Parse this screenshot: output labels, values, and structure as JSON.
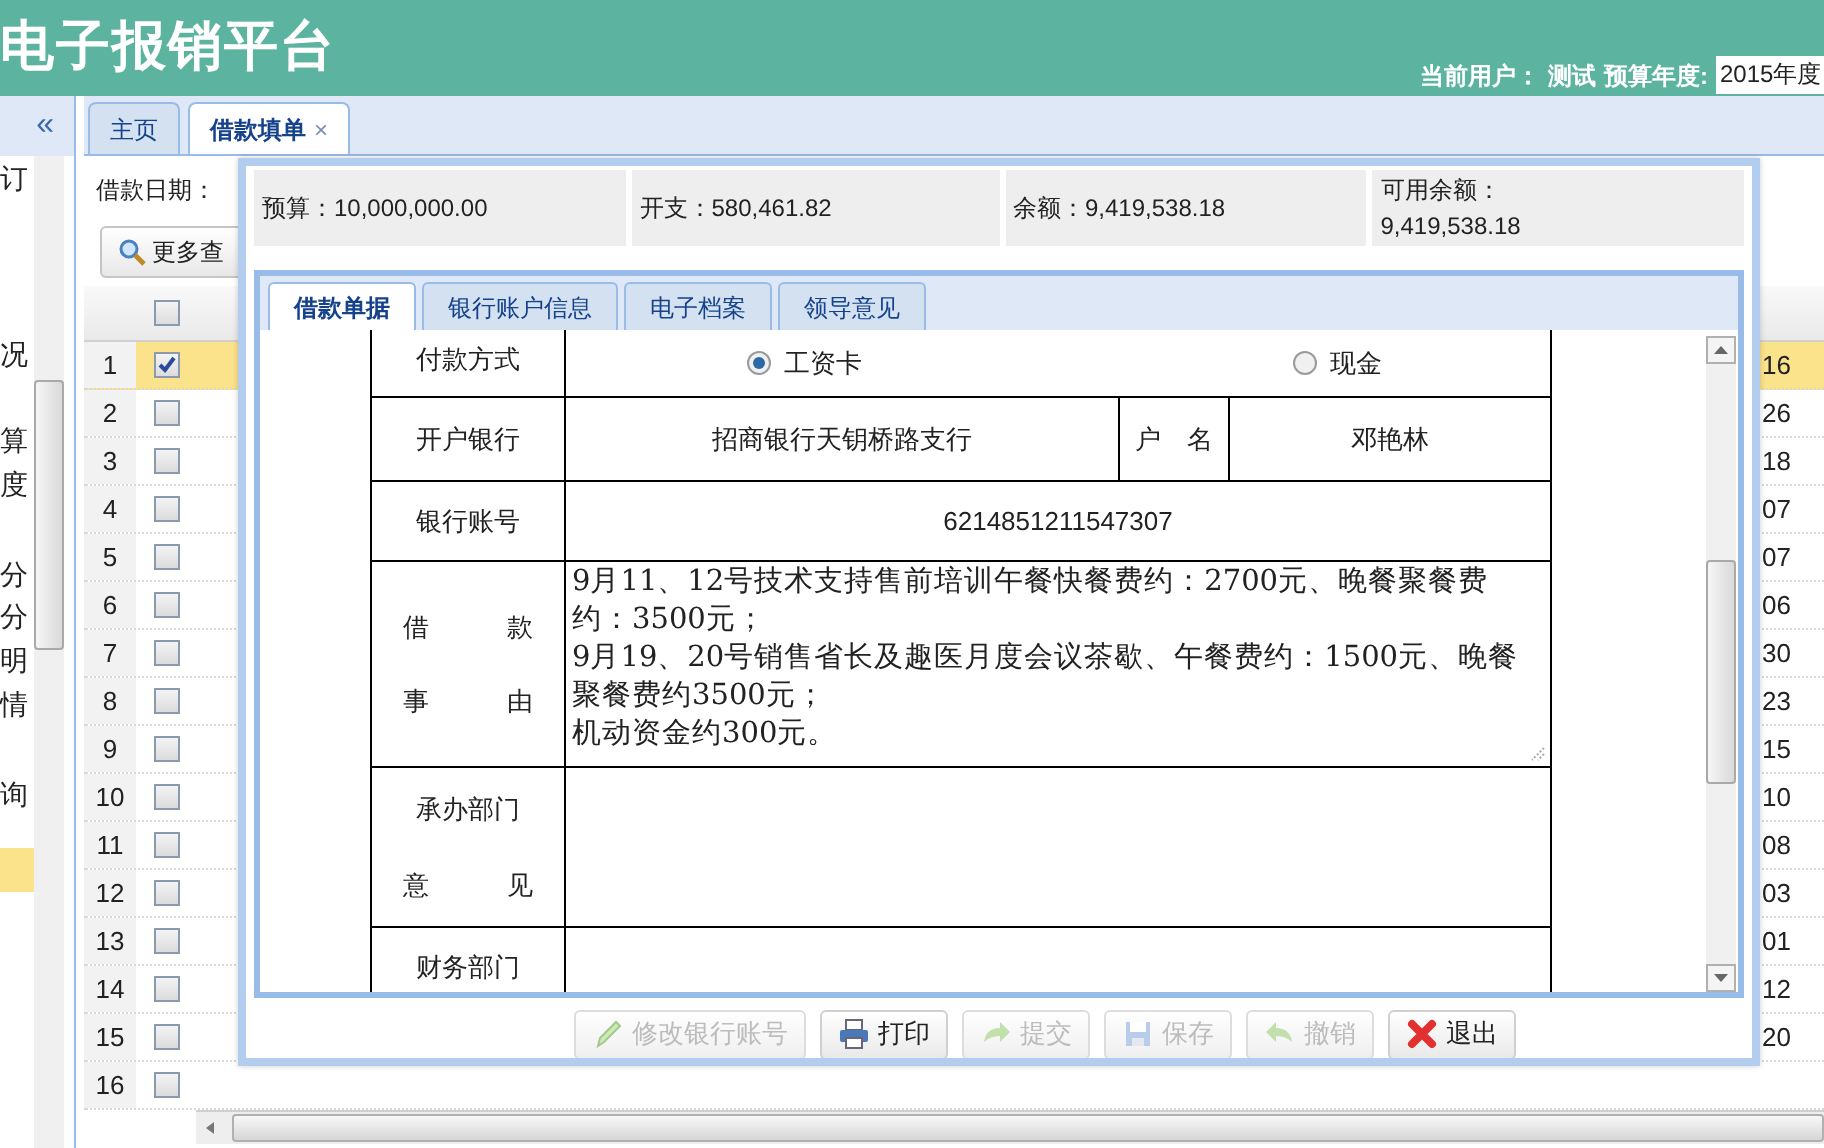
{
  "header": {
    "title": "电子报销平台",
    "user_label": "当前用户：",
    "user_name": "测试",
    "year_label": "预算年度:",
    "year_value": "2015年度"
  },
  "sidebar": {
    "collapse": "«",
    "items": [
      {
        "text": "订",
        "selected": false
      },
      {
        "text": "况",
        "selected": false
      },
      {
        "text": "算",
        "selected": false
      },
      {
        "text": "度",
        "selected": false
      },
      {
        "text": "分",
        "selected": false
      },
      {
        "text": "分",
        "selected": false
      },
      {
        "text": "明",
        "selected": false
      },
      {
        "text": "情",
        "selected": false
      },
      {
        "text": "询",
        "selected": false
      },
      {
        "selected": true
      }
    ]
  },
  "tabs": [
    {
      "label": "主页",
      "selected": false
    },
    {
      "label": "借款填单",
      "selected": true,
      "close": "×"
    }
  ],
  "grid": {
    "date_label": "借款日期：",
    "more_button": "更多查",
    "header_checked": false,
    "rows": [
      {
        "number": "1",
        "checked": true,
        "selected": true,
        "last": "16"
      },
      {
        "number": "2",
        "checked": false,
        "selected": false,
        "last": "26"
      },
      {
        "number": "3",
        "checked": false,
        "selected": false,
        "last": "18"
      },
      {
        "number": "4",
        "checked": false,
        "selected": false,
        "last": "07"
      },
      {
        "number": "5",
        "checked": false,
        "selected": false,
        "last": "07"
      },
      {
        "number": "6",
        "checked": false,
        "selected": false,
        "last": "06"
      },
      {
        "number": "7",
        "checked": false,
        "selected": false,
        "last": "30"
      },
      {
        "number": "8",
        "checked": false,
        "selected": false,
        "last": "23"
      },
      {
        "number": "9",
        "checked": false,
        "selected": false,
        "last": "15"
      },
      {
        "number": "10",
        "checked": false,
        "selected": false,
        "last": "10"
      },
      {
        "number": "11",
        "checked": false,
        "selected": false,
        "last": "08"
      },
      {
        "number": "12",
        "checked": false,
        "selected": false,
        "last": "03"
      },
      {
        "number": "13",
        "checked": false,
        "selected": false,
        "last": "01"
      },
      {
        "number": "14",
        "checked": false,
        "selected": false,
        "last": "12"
      },
      {
        "number": "15",
        "checked": false,
        "selected": false,
        "last": "20"
      },
      {
        "number": "16",
        "checked": false,
        "selected": false
      }
    ]
  },
  "dialog": {
    "summary": [
      {
        "label": "预算：",
        "value": "10,000,000.00"
      },
      {
        "label": "开支：",
        "value": "580,461.82"
      },
      {
        "label": "余额：",
        "value": "9,419,538.18"
      },
      {
        "label": "可用余额：",
        "value": "9,419,538.18"
      }
    ],
    "tabs": [
      {
        "label": "借款单据",
        "selected": true
      },
      {
        "label": "银行账户信息",
        "selected": false
      },
      {
        "label": "电子档案",
        "selected": false
      },
      {
        "label": "领导意见",
        "selected": false
      }
    ],
    "form": [
      {
        "kind": "radio",
        "label_lines": [
          "付款方式"
        ],
        "options": [
          {
            "label": "工资卡",
            "selected": true
          },
          {
            "label": "现金",
            "selected": false
          }
        ]
      },
      {
        "kind": "bank",
        "label_lines": [
          "开户银行"
        ],
        "value": "招商银行天钥桥路支行",
        "label2": "户　名",
        "value2": "邓艳林"
      },
      {
        "kind": "text",
        "label_lines": [
          "银行账号"
        ],
        "value": "6214851211547307"
      },
      {
        "kind": "textarea",
        "label_lines": [
          "借　　　款",
          "事　　　由"
        ],
        "lines": [
          "9月11、12号技术支持售前培训午餐快餐费约：2700元、晚餐聚餐费约：3500元；",
          "9月19、20号销售省长及趣医月度会议茶歇、午餐费约：1500元、晚餐聚餐费约3500元；",
          "机动资金约300元。"
        ]
      },
      {
        "kind": "empty",
        "label_lines": [
          "承办部门",
          "意　　　见"
        ]
      },
      {
        "kind": "empty",
        "label_lines": [
          "财务部门"
        ]
      }
    ],
    "buttons": [
      {
        "label": "修改银行账号",
        "disabled": true
      },
      {
        "label": "打印",
        "disabled": false
      },
      {
        "label": "提交",
        "disabled": true
      },
      {
        "label": "保存",
        "disabled": true
      },
      {
        "label": "撤销",
        "disabled": true
      },
      {
        "label": "退出",
        "disabled": false
      }
    ]
  }
}
